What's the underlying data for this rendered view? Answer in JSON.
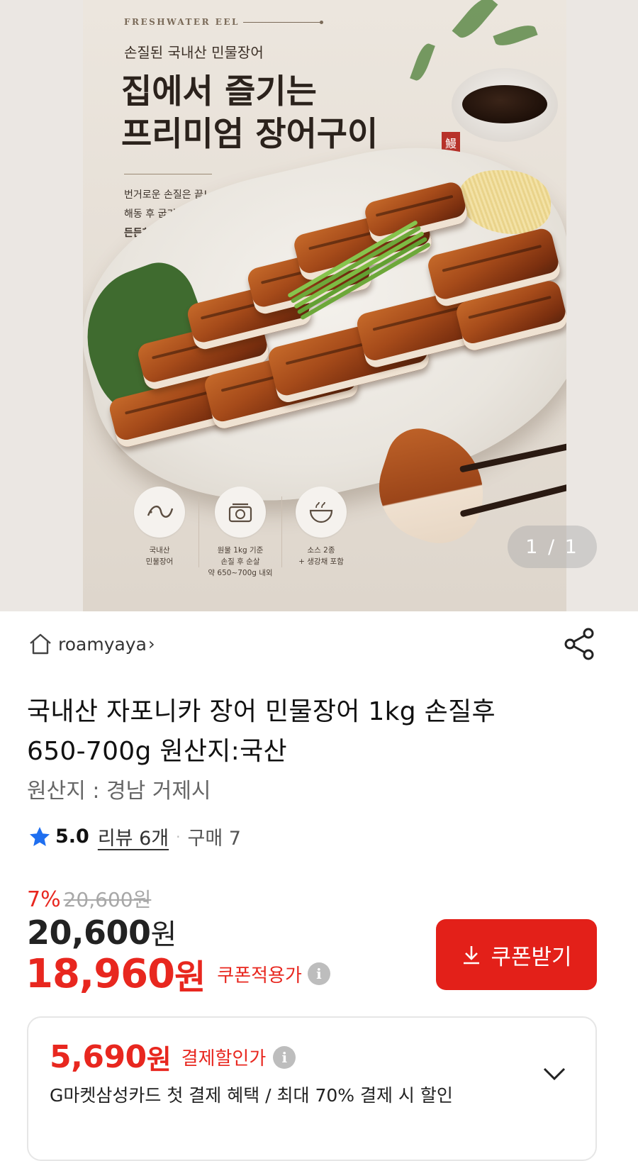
{
  "hero": {
    "tag": "FRESHWATER EEL",
    "subtitle": "손질된 국내산 민물장어",
    "title_line1": "집에서 즐기는",
    "title_line2": "프리미엄 장어구이",
    "seal_char": "鰻",
    "desc_line1": "번거로운 손질은 끝!",
    "desc_line2": "해동 후 굽기만 하면 완성되는",
    "desc_line3": "든든한 장어 한 상",
    "features": [
      {
        "icon": "eel-icon",
        "text": "국내산\n민물장어"
      },
      {
        "icon": "scale-icon",
        "text": "원물 1kg 기준\n손질 후 순살\n약 650~700g 내외"
      },
      {
        "icon": "bowl-icon",
        "text": "소스 2종\n+ 생강채 포함"
      }
    ],
    "counter": "1 / 1"
  },
  "store": {
    "name": "roamyaya",
    "chevron": "›"
  },
  "product": {
    "title": "국내산 자포니카 장어 민물장어 1kg 손질후 650-700g 원산지:국산",
    "origin": "원산지 : 경남 거제시"
  },
  "rating": {
    "score": "5.0",
    "reviews": "리뷰 6개",
    "separator": "·",
    "purchases": "구매 7"
  },
  "price": {
    "discount_pct": "7%",
    "original": "20,600",
    "original_unit": "원",
    "sale": "20,600",
    "sale_unit": "원",
    "coupon_price": "18,960",
    "coupon_unit": "원",
    "coupon_label": "쿠폰적용가",
    "info_glyph": "i"
  },
  "coupon_button": {
    "label": "쿠폰받기"
  },
  "payment_card": {
    "amount": "5,690",
    "unit": "원",
    "label": "결제할인가",
    "info_glyph": "i",
    "desc": "G마켓삼성카드 첫 결제 혜택 / 최대 70% 결제 시 할인"
  },
  "colors": {
    "accent_red": "#e32019",
    "price_red": "#e8271f"
  }
}
